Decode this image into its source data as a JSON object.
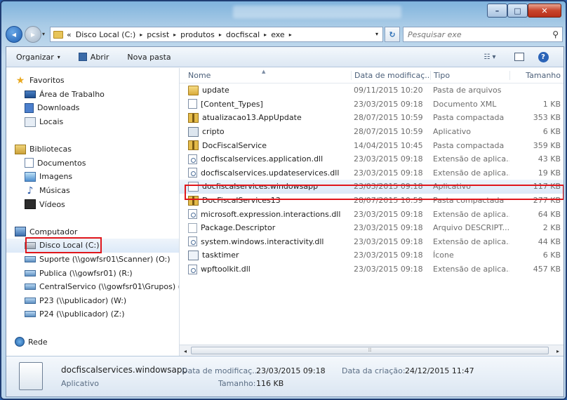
{
  "window": {
    "minimize": "–",
    "maximize": "□",
    "close": "✕"
  },
  "address": {
    "overflow": "«",
    "crumbs": [
      "Disco Local (C:)",
      "pcsist",
      "produtos",
      "docfiscal",
      "exe"
    ],
    "separator": "▸",
    "refresh": "↻"
  },
  "search": {
    "placeholder": "Pesquisar exe",
    "icon": "search-icon"
  },
  "toolbar": {
    "organize": "Organizar",
    "open": "Abrir",
    "new_folder": "Nova pasta",
    "view_icon": "view-options-icon",
    "preview_icon": "preview-pane-icon",
    "help": "?"
  },
  "nav": {
    "favorites": "Favoritos",
    "desktop": "Área de Trabalho",
    "downloads": "Downloads",
    "locals": "Locais",
    "libraries": "Bibliotecas",
    "documents": "Documentos",
    "images": "Imagens",
    "music": "Músicas",
    "videos": "Vídeos",
    "computer": "Computador",
    "local_disk": "Disco Local (C:)",
    "support": "Suporte (\\\\gowfsr01\\Scanner) (O:)",
    "public": "Publica (\\\\gowfsr01) (R:)",
    "central": "CentralServico (\\\\gowfsr01\\Grupos) (S",
    "p23": "P23 (\\\\publicador) (W:)",
    "p24": "P24 (\\\\publicador) (Z:)",
    "network": "Rede"
  },
  "columns": {
    "name": "Nome",
    "date": "Data de modificaç...",
    "type": "Tipo",
    "size": "Tamanho"
  },
  "files": [
    {
      "name": "update",
      "date": "09/11/2015 10:20",
      "type": "Pasta de arquivos",
      "size": "",
      "icon": "folder"
    },
    {
      "name": "[Content_Types]",
      "date": "23/03/2015 09:18",
      "type": "Documento XML",
      "size": "1 KB",
      "icon": "xml"
    },
    {
      "name": "atualizacao13.AppUpdate",
      "date": "28/07/2015 10:59",
      "type": "Pasta compactada",
      "size": "353 KB",
      "icon": "zip"
    },
    {
      "name": "cripto",
      "date": "28/07/2015 10:59",
      "type": "Aplicativo",
      "size": "6 KB",
      "icon": "app"
    },
    {
      "name": "DocFiscalService",
      "date": "14/04/2015 10:45",
      "type": "Pasta compactada",
      "size": "359 KB",
      "icon": "zip"
    },
    {
      "name": "docfiscalservices.application.dll",
      "date": "23/03/2015 09:18",
      "type": "Extensão de aplica...",
      "size": "43 KB",
      "icon": "dll"
    },
    {
      "name": "docfiscalservices.updateservices.dll",
      "date": "23/03/2015 09:18",
      "type": "Extensão de aplica...",
      "size": "19 KB",
      "icon": "dll"
    },
    {
      "name": "docfiscalservices.windowsapp",
      "date": "23/03/2015 09:18",
      "type": "Aplicativo",
      "size": "117 KB",
      "icon": "wapp"
    },
    {
      "name": "DocFiscalServices13",
      "date": "28/07/2015 10:59",
      "type": "Pasta compactada",
      "size": "277 KB",
      "icon": "zip"
    },
    {
      "name": "microsoft.expression.interactions.dll",
      "date": "23/03/2015 09:18",
      "type": "Extensão de aplica...",
      "size": "64 KB",
      "icon": "dll"
    },
    {
      "name": "Package.Descriptor",
      "date": "23/03/2015 09:18",
      "type": "Arquivo DESCRIPT...",
      "size": "2 KB",
      "icon": "desc"
    },
    {
      "name": "system.windows.interactivity.dll",
      "date": "23/03/2015 09:18",
      "type": "Extensão de aplica...",
      "size": "44 KB",
      "icon": "dll"
    },
    {
      "name": "tasktimer",
      "date": "23/03/2015 09:18",
      "type": "Ícone",
      "size": "6 KB",
      "icon": "task"
    },
    {
      "name": "wpftoolkit.dll",
      "date": "23/03/2015 09:18",
      "type": "Extensão de aplica...",
      "size": "457 KB",
      "icon": "dll"
    }
  ],
  "details": {
    "name": "docfiscalservices.windowsapp",
    "type": "Aplicativo",
    "modified_label": "Data de modificaç...",
    "modified_value": "23/03/2015 09:18",
    "size_label": "Tamanho:",
    "size_value": "116 KB",
    "created_label": "Data da criação:",
    "created_value": "24/12/2015 11:47"
  },
  "scrollbar": {
    "left": "◂",
    "right": "▸",
    "grip": "⦙⦙⦙"
  },
  "colors": {
    "highlight": "#e0161b",
    "selection": "#dce9f8",
    "title_blue": "#2a5fa8"
  }
}
